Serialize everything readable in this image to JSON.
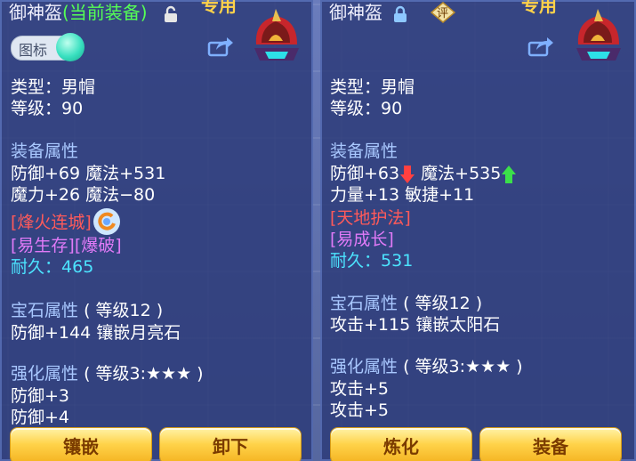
{
  "left": {
    "title": "御神盔",
    "title_tag": "(当前装备)",
    "exclusive": "专用",
    "icon_toggle_label": "图标",
    "type_label": "类型：男帽",
    "level_label": "等级：90",
    "attr_header": "装备属性",
    "attr_line1": "防御+69 魔法+531",
    "attr_line2": "魔力+26 魔法−80",
    "skill": "[烽火连城]",
    "special": "[易生存][爆破]",
    "durability_label": "耐久：",
    "durability_value": "465",
    "gem_header": "宝石属性",
    "gem_level": "( 等级12 )",
    "gem_line": "防御+144 镶嵌月亮石",
    "enh_header": "强化属性",
    "enh_level": "( 等级3:★★★ )",
    "enh_line1": "防御+3",
    "enh_line2": "防御+4",
    "btn_inlay": "镶嵌",
    "btn_unequip": "卸下"
  },
  "right": {
    "title": "御神盔",
    "rating_badge": "评",
    "exclusive": "专用",
    "type_label": "类型：男帽",
    "level_label": "等级：90",
    "attr_header": "装备属性",
    "attr_def": "防御+63",
    "attr_magic": "魔法+535",
    "attr_line2": "力量+13 敏捷+11",
    "skill": "[天地护法]",
    "special": "[易成长]",
    "durability_label": "耐久：",
    "durability_value": "531",
    "gem_header": "宝石属性",
    "gem_level": "( 等级12 )",
    "gem_line": "攻击+115 镶嵌太阳石",
    "enh_header": "强化属性",
    "enh_level": "( 等级3:★★★ )",
    "enh_line1": "攻击+5",
    "enh_line2": "攻击+5",
    "btn_refine": "炼化",
    "btn_equip": "装备"
  },
  "colors": {
    "section": "#a9c8ff",
    "skill_red": "#ff5a5a",
    "special_purple": "#e07af7",
    "durability_cyan": "#4ce4ff",
    "current_green": "#55ff55",
    "exclusive_gold": "#ffd24a",
    "down_arrow": "#ff4040",
    "up_arrow": "#3be04a"
  },
  "icons": {
    "helmet": "helmet-icon",
    "lock": "lock-icon",
    "share": "share-icon",
    "skill_swirl": "swirl-icon",
    "down": "arrow-down-icon",
    "up": "arrow-up-icon"
  }
}
